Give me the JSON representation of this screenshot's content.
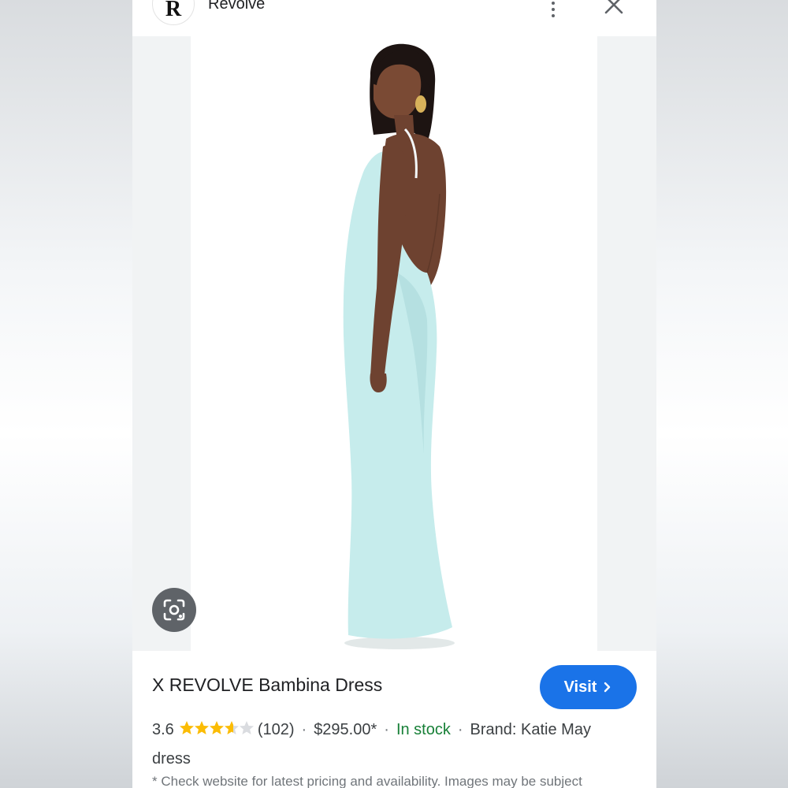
{
  "header": {
    "logo_letter": "R",
    "site_name": "Revolve"
  },
  "product": {
    "title": "X REVOLVE Bambina Dress",
    "rating": "3.6",
    "rating_value": 3.6,
    "review_count": "(102)",
    "price": "$295.00*",
    "availability": "In stock",
    "brand": "Brand: Katie May",
    "category": "dress",
    "visit_label": "Visit",
    "disclaimer": "* Check website for latest pricing and availability. Images may be subject"
  },
  "icons": {
    "lens": "google-lens-icon",
    "menu": "more-vert-icon",
    "close": "close-icon",
    "visit_arrow": "chevron-right-icon"
  },
  "colors": {
    "accent": "#1a73e8",
    "in_stock": "#188038",
    "star": "#fbbc04",
    "dress": "#c6ecec"
  }
}
